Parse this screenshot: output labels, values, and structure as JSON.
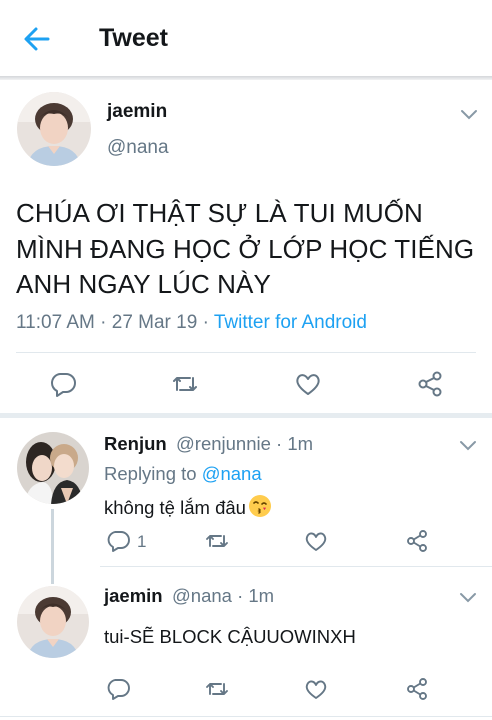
{
  "header": {
    "title": "Tweet"
  },
  "tweet": {
    "author_name": "jaemin",
    "author_handle": "@nana",
    "text": "CHÚA ƠI THẬT SỰ LÀ TUI MUỐN MÌNH ĐANG HỌC Ở LỚP HỌC TIẾNG ANH NGAY LÚC NÀY",
    "time": "11:07 AM · 27 Mar 19 · ",
    "source": "Twitter for Android"
  },
  "replies": [
    {
      "name": "Renjun",
      "handle": "@renjunnie · 1m",
      "replying_prefix": "Replying to ",
      "replying_to": "@nana",
      "text": "không tệ lắm đâu",
      "emoji": "kissing-face-emoji",
      "reply_count": "1"
    },
    {
      "name": "jaemin",
      "handle": "@nana · 1m",
      "text": "tui-SẼ BLOCK CẬUUOWINXH"
    }
  ],
  "colors": {
    "accent": "#1da1f2",
    "secondary_text": "#657786",
    "divider": "#e1e8ed"
  }
}
